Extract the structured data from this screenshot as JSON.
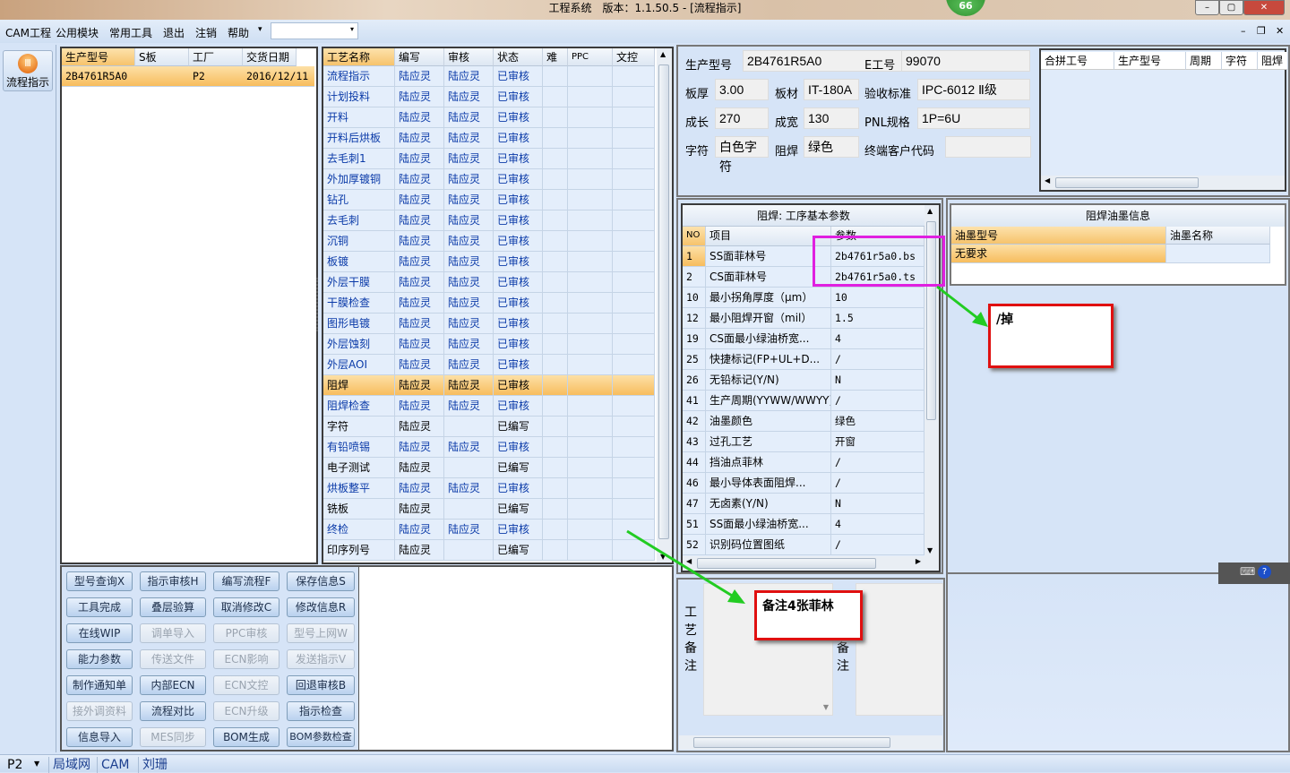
{
  "window": {
    "title": "工程系统　版本：1.1.50.5 - [流程指示]",
    "badge": "66"
  },
  "menu": [
    "CAM工程",
    "公用模块",
    "常用工具",
    "退出",
    "注销",
    "帮助"
  ],
  "sidebar": {
    "button": "流程指示"
  },
  "orders": {
    "headers": [
      "生产型号",
      "S板",
      "工厂",
      "交货日期"
    ],
    "rows": [
      [
        "2B4761R5A0",
        "",
        "P2",
        "2016/12/11"
      ]
    ]
  },
  "process": {
    "headers": [
      "工艺名称",
      "编写",
      "审核",
      "状态",
      "难",
      "PPC",
      "文控"
    ],
    "rows": [
      [
        "流程指示",
        "陆应灵",
        "陆应灵",
        "已审核"
      ],
      [
        "计划投料",
        "陆应灵",
        "陆应灵",
        "已审核"
      ],
      [
        "开料",
        "陆应灵",
        "陆应灵",
        "已审核"
      ],
      [
        "开料后烘板",
        "陆应灵",
        "陆应灵",
        "已审核"
      ],
      [
        "去毛刺1",
        "陆应灵",
        "陆应灵",
        "已审核"
      ],
      [
        "外加厚镀铜",
        "陆应灵",
        "陆应灵",
        "已审核"
      ],
      [
        "钻孔",
        "陆应灵",
        "陆应灵",
        "已审核"
      ],
      [
        "去毛刺",
        "陆应灵",
        "陆应灵",
        "已审核"
      ],
      [
        "沉铜",
        "陆应灵",
        "陆应灵",
        "已审核"
      ],
      [
        "板镀",
        "陆应灵",
        "陆应灵",
        "已审核"
      ],
      [
        "外层干膜",
        "陆应灵",
        "陆应灵",
        "已审核"
      ],
      [
        "干膜检查",
        "陆应灵",
        "陆应灵",
        "已审核"
      ],
      [
        "图形电镀",
        "陆应灵",
        "陆应灵",
        "已审核"
      ],
      [
        "外层蚀刻",
        "陆应灵",
        "陆应灵",
        "已审核"
      ],
      [
        "外层AOI",
        "陆应灵",
        "陆应灵",
        "已审核"
      ],
      [
        "阻焊",
        "陆应灵",
        "陆应灵",
        "已审核"
      ],
      [
        "阻焊检查",
        "陆应灵",
        "陆应灵",
        "已审核"
      ],
      [
        "字符",
        "陆应灵",
        "",
        "已编写"
      ],
      [
        "有铅喷锡",
        "陆应灵",
        "陆应灵",
        "已审核"
      ],
      [
        "电子测试",
        "陆应灵",
        "",
        "已编写"
      ],
      [
        "烘板整平",
        "陆应灵",
        "陆应灵",
        "已审核"
      ],
      [
        "铣板",
        "陆应灵",
        "",
        "已编写"
      ],
      [
        "终检",
        "陆应灵",
        "陆应灵",
        "已审核"
      ],
      [
        "印序列号",
        "陆应灵",
        "",
        "已编写"
      ]
    ],
    "selected": 15
  },
  "buttons": [
    [
      "型号查询X",
      1
    ],
    [
      "指示审核H",
      1
    ],
    [
      "编写流程F",
      1
    ],
    [
      "保存信息S",
      1
    ],
    [
      "工具完成",
      1
    ],
    [
      "叠层验算",
      1
    ],
    [
      "取消修改C",
      1
    ],
    [
      "修改信息R",
      1
    ],
    [
      "在线WIP",
      1
    ],
    [
      "调单导入",
      0
    ],
    [
      "PPC审核",
      0
    ],
    [
      "型号上网W",
      0
    ],
    [
      "能力参数",
      1
    ],
    [
      "传送文件",
      0
    ],
    [
      "ECN影响",
      0
    ],
    [
      "发送指示V",
      0
    ],
    [
      "制作通知单",
      1
    ],
    [
      "内部ECN",
      1
    ],
    [
      "ECN文控",
      0
    ],
    [
      "回退审核B",
      1
    ],
    [
      "接外调资料",
      0
    ],
    [
      "流程对比",
      1
    ],
    [
      "ECN升级",
      0
    ],
    [
      "指示检查",
      1
    ],
    [
      "信息导入",
      1
    ],
    [
      "MES同步",
      0
    ],
    [
      "BOM生成",
      1
    ],
    [
      "BOM参数检查",
      1
    ]
  ],
  "info": [
    [
      "生产型号",
      "2B4761R5A0"
    ],
    [
      "E工号",
      "99070"
    ],
    [
      "板厚",
      "3.00"
    ],
    [
      "板材",
      "IT-180A"
    ],
    [
      "验收标准",
      "IPC-6012 Ⅱ级"
    ],
    [
      "成长",
      "270"
    ],
    [
      "成宽",
      "130"
    ],
    [
      "PNL规格",
      "1P=6U"
    ],
    [
      "字符",
      "白色字符"
    ],
    [
      "阻焊",
      "绿色"
    ],
    [
      "终端客户代码",
      ""
    ]
  ],
  "merge": {
    "headers": [
      "合拼工号",
      "生产型号",
      "周期",
      "字符",
      "阻焊"
    ]
  },
  "params": {
    "title": "阻焊: 工序基本参数",
    "headers": [
      "NO",
      "项目",
      "参数"
    ],
    "rows": [
      [
        "1",
        "SS面菲林号",
        "2b4761r5a0.bs"
      ],
      [
        "2",
        "CS面菲林号",
        "2b4761r5a0.ts"
      ],
      [
        "10",
        "最小拐角厚度（μm）",
        "10"
      ],
      [
        "12",
        "最小阻焊开窗（mil）",
        "1.5"
      ],
      [
        "19",
        "CS面最小绿油桥宽...",
        "4"
      ],
      [
        "25",
        "快捷标记(FP+UL+D...",
        "/"
      ],
      [
        "26",
        "无铅标记(Y/N)",
        "N"
      ],
      [
        "41",
        "生产周期(YYWW/WWYY)",
        "/"
      ],
      [
        "42",
        "油墨颜色",
        "绿色"
      ],
      [
        "43",
        "过孔工艺",
        "开窗"
      ],
      [
        "44",
        "挡油点菲林",
        "/"
      ],
      [
        "46",
        "最小导体表面阻焊...",
        "/"
      ],
      [
        "47",
        "无卤素(Y/N)",
        "N"
      ],
      [
        "51",
        "SS面最小绿油桥宽...",
        "4"
      ],
      [
        "52",
        "识别码位置图纸",
        "/"
      ]
    ]
  },
  "oil": {
    "title": "阻焊油墨信息",
    "headers": [
      "油墨型号",
      "油墨名称"
    ],
    "rows": [
      [
        "无要求",
        ""
      ]
    ]
  },
  "remarks": {
    "process_label": "工艺备注",
    "other_label": "备注"
  },
  "annotations": {
    "note1": "/掉",
    "note2": "备注4张菲林",
    "colors": {
      "highlight": "#e020e0",
      "note_border": "#e01010",
      "arrow": "#22cc22"
    }
  },
  "statusbar": [
    "P2",
    "局域网",
    "CAM",
    "刘珊"
  ]
}
